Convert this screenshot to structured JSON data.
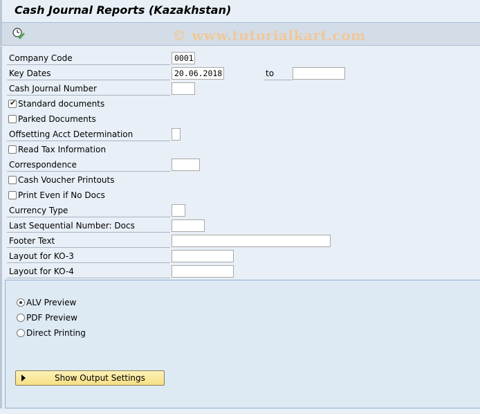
{
  "window": {
    "title": "Cash Journal Reports (Kazakhstan)",
    "watermark": "© www.tutorialkart.com"
  },
  "toolbar": {
    "execute_icon": "execute-clock-check-icon"
  },
  "form": {
    "company_code": {
      "label": "Company Code",
      "value": "0001"
    },
    "key_dates": {
      "label": "Key Dates",
      "from": "20.06.2018",
      "to_label": "to",
      "to": ""
    },
    "cash_journal_number": {
      "label": "Cash Journal Number",
      "value": ""
    },
    "standard_documents": {
      "label": "Standard documents",
      "checked": true
    },
    "parked_documents": {
      "label": "Parked Documents",
      "checked": false
    },
    "offsetting_acct": {
      "label": "Offsetting Acct Determination",
      "value": ""
    },
    "read_tax_info": {
      "label": "Read Tax Information",
      "checked": false
    },
    "correspondence": {
      "label": "Correspondence",
      "value": ""
    },
    "cash_voucher_printouts": {
      "label": "Cash Voucher Printouts",
      "checked": false
    },
    "print_even_if_no_docs": {
      "label": "Print Even if No Docs",
      "checked": false
    },
    "currency_type": {
      "label": "Currency Type",
      "value": ""
    },
    "last_sequential_number": {
      "label": "Last Sequential Number: Docs",
      "value": ""
    },
    "footer_text": {
      "label": "Footer Text",
      "value": ""
    },
    "layout_ko3": {
      "label": "Layout for KO-3",
      "value": ""
    },
    "layout_ko4": {
      "label": "Layout for KO-4",
      "value": ""
    }
  },
  "output": {
    "options": [
      {
        "label": "ALV Preview",
        "selected": true
      },
      {
        "label": "PDF Preview",
        "selected": false
      },
      {
        "label": "Direct Printing",
        "selected": false
      }
    ],
    "show_settings_button": "Show Output Settings"
  }
}
